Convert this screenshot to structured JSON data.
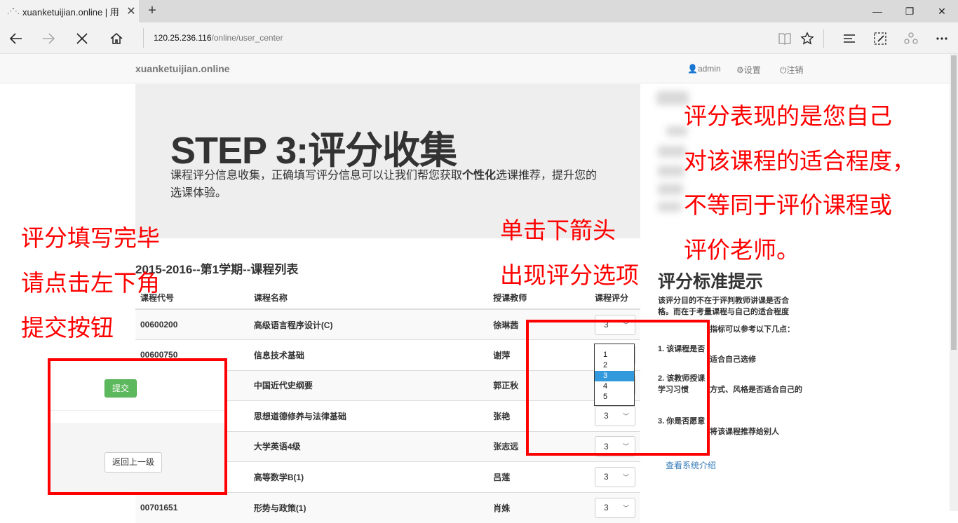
{
  "browser": {
    "tab_title": "xuanketuijian.online | 用",
    "tab_close": "✕",
    "new_tab": "+",
    "minimize": "—",
    "restore": "❐",
    "close": "✕",
    "address_host": "120.25.236.116",
    "address_path": "/online/user_center"
  },
  "site": {
    "brand": "xuanketuijian.online",
    "nav_user": "admin",
    "nav_settings": "设置",
    "nav_logout": "注销"
  },
  "jumbo": {
    "title": "STEP 3:评分收集",
    "desc_pre": "课程评分信息收集，正确填写评分信息可以让我们帮您获取",
    "desc_bold": "个性化",
    "desc_post": "选课推荐，提升您的选课体验。"
  },
  "courses": {
    "title": "2015-2016--第1学期--课程列表",
    "headers": [
      "课程代号",
      "课程名称",
      "授课教师",
      "课程评分"
    ],
    "rows": [
      {
        "code": "00600200",
        "name": "高级语言程序设计(C)",
        "teacher": "徐琳茜",
        "score": "3"
      },
      {
        "code": "00600750",
        "name": "信息技术基础",
        "teacher": "谢萍",
        "score": "3"
      },
      {
        "code": "",
        "name": "中国近代史纲要",
        "teacher": "郭正秋",
        "score": "3"
      },
      {
        "code": "",
        "name": "思想道德修养与法律基础",
        "teacher": "张艳",
        "score": "3"
      },
      {
        "code": "",
        "name": "大学英语4级",
        "teacher": "张志远",
        "score": "3"
      },
      {
        "code": "",
        "name": "高等数学B(1)",
        "teacher": "吕莲",
        "score": "3"
      },
      {
        "code": "00701651",
        "name": "形势与政策(1)",
        "teacher": "肖姝",
        "score": "3"
      }
    ],
    "dropdown_options": [
      "1",
      "2",
      "3",
      "4",
      "5"
    ],
    "dropdown_selected": "3"
  },
  "actions": {
    "submit": "提交",
    "back": "返回上一级"
  },
  "sidebar": {
    "heading": "评分标准提示",
    "intro1": "该评分目的不在于评判教师讲课是否合",
    "intro2": "格。而在于考量课程与自己的适合程度",
    "intro3": "指标可以参考以下几点：",
    "p1a": "1. 该课程是否",
    "p1b": "适合自己选修",
    "p2a": "2. 该教师授课",
    "p2b": "学习习惯",
    "p2c": "方式、风格是否适合自己的",
    "p3a": "3. 你是否愿意",
    "p3b": "将该课程推荐给别人",
    "link": "查看系统介绍"
  },
  "annotations": {
    "left": [
      "评分填写完毕",
      "请点击左下角",
      "提交按钮"
    ],
    "middle": [
      "单击下箭头",
      "出现评分选项"
    ],
    "right": [
      "评分表现的是您自己",
      "对该课程的适合程度，",
      "不等同于评价课程或",
      "评价老师。"
    ]
  },
  "colors": {
    "annotation_red": "#ff0000",
    "submit_green": "#5cb85c",
    "link_blue": "#337ab7"
  }
}
